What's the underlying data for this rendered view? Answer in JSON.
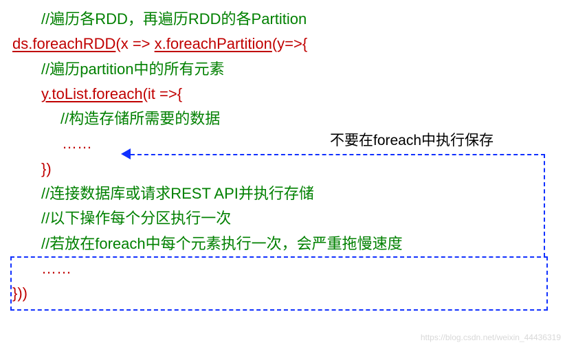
{
  "code": {
    "l01": "//遍历各RDD，再遍历RDD的各Partition",
    "l02a": "ds.foreachRDD",
    "l02b": "(x => ",
    "l02c": "x.foreachPartition",
    "l02d": "(y=>{",
    "l03": "//遍历partition中的所有元素",
    "l04a": "y.toList.foreach",
    "l04b": "(it =>{",
    "l05": "//构造存储所需要的数据",
    "l06": "……",
    "l07": "})",
    "l08": "//连接数据库或请求REST API并执行存储",
    "l09": "//以下操作每个分区执行一次",
    "l10": "//若放在foreach中每个元素执行一次，会严重拖慢速度",
    "l11": "……",
    "l12": "}))"
  },
  "annotation": {
    "label": "不要在foreach中执行保存"
  },
  "watermark": "https://blog.csdn.net/weixin_44436319"
}
